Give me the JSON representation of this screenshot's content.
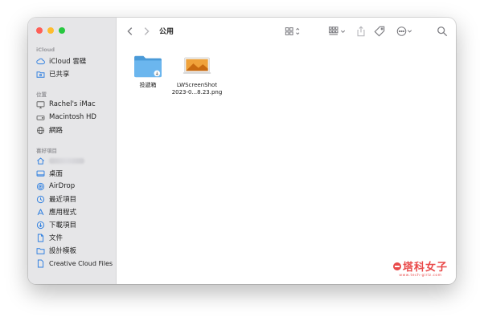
{
  "window": {
    "title": "公用"
  },
  "colors": {
    "close": "#fe5f57",
    "minimize": "#febc2e",
    "zoom": "#28c840",
    "accent": "#2f7fe0",
    "folder": "#5aa9e6"
  },
  "sidebar": {
    "sections": [
      {
        "heading": "iCloud",
        "items": [
          {
            "label": "iCloud 雲碟",
            "icon": "cloud-icon"
          },
          {
            "label": "已共享",
            "icon": "shared-folder-icon"
          }
        ]
      },
      {
        "heading": "位置",
        "items": [
          {
            "label": "Rachel's iMac",
            "icon": "imac-icon"
          },
          {
            "label": "Macintosh HD",
            "icon": "disk-icon"
          },
          {
            "label": "網路",
            "icon": "globe-icon"
          }
        ]
      },
      {
        "heading": "喜好項目",
        "items": [
          {
            "label": "",
            "icon": "home-icon"
          },
          {
            "label": "桌面",
            "icon": "desktop-icon"
          },
          {
            "label": "AirDrop",
            "icon": "airdrop-icon"
          },
          {
            "label": "最近項目",
            "icon": "clock-icon"
          },
          {
            "label": "應用程式",
            "icon": "apps-icon"
          },
          {
            "label": "下載項目",
            "icon": "download-icon"
          },
          {
            "label": "文件",
            "icon": "document-icon"
          },
          {
            "label": "設計模板",
            "icon": "folder-icon"
          },
          {
            "label": "Creative Cloud Files",
            "icon": "file-icon"
          }
        ]
      }
    ]
  },
  "files": [
    {
      "name": "投遞箱",
      "kind": "folder"
    },
    {
      "name_line1": "LWScreenShot",
      "name_line2": "2023-0...8.23.png",
      "kind": "image"
    }
  ],
  "watermark": {
    "main": "塔科女子",
    "sub": "www.tech-girlz.com"
  }
}
